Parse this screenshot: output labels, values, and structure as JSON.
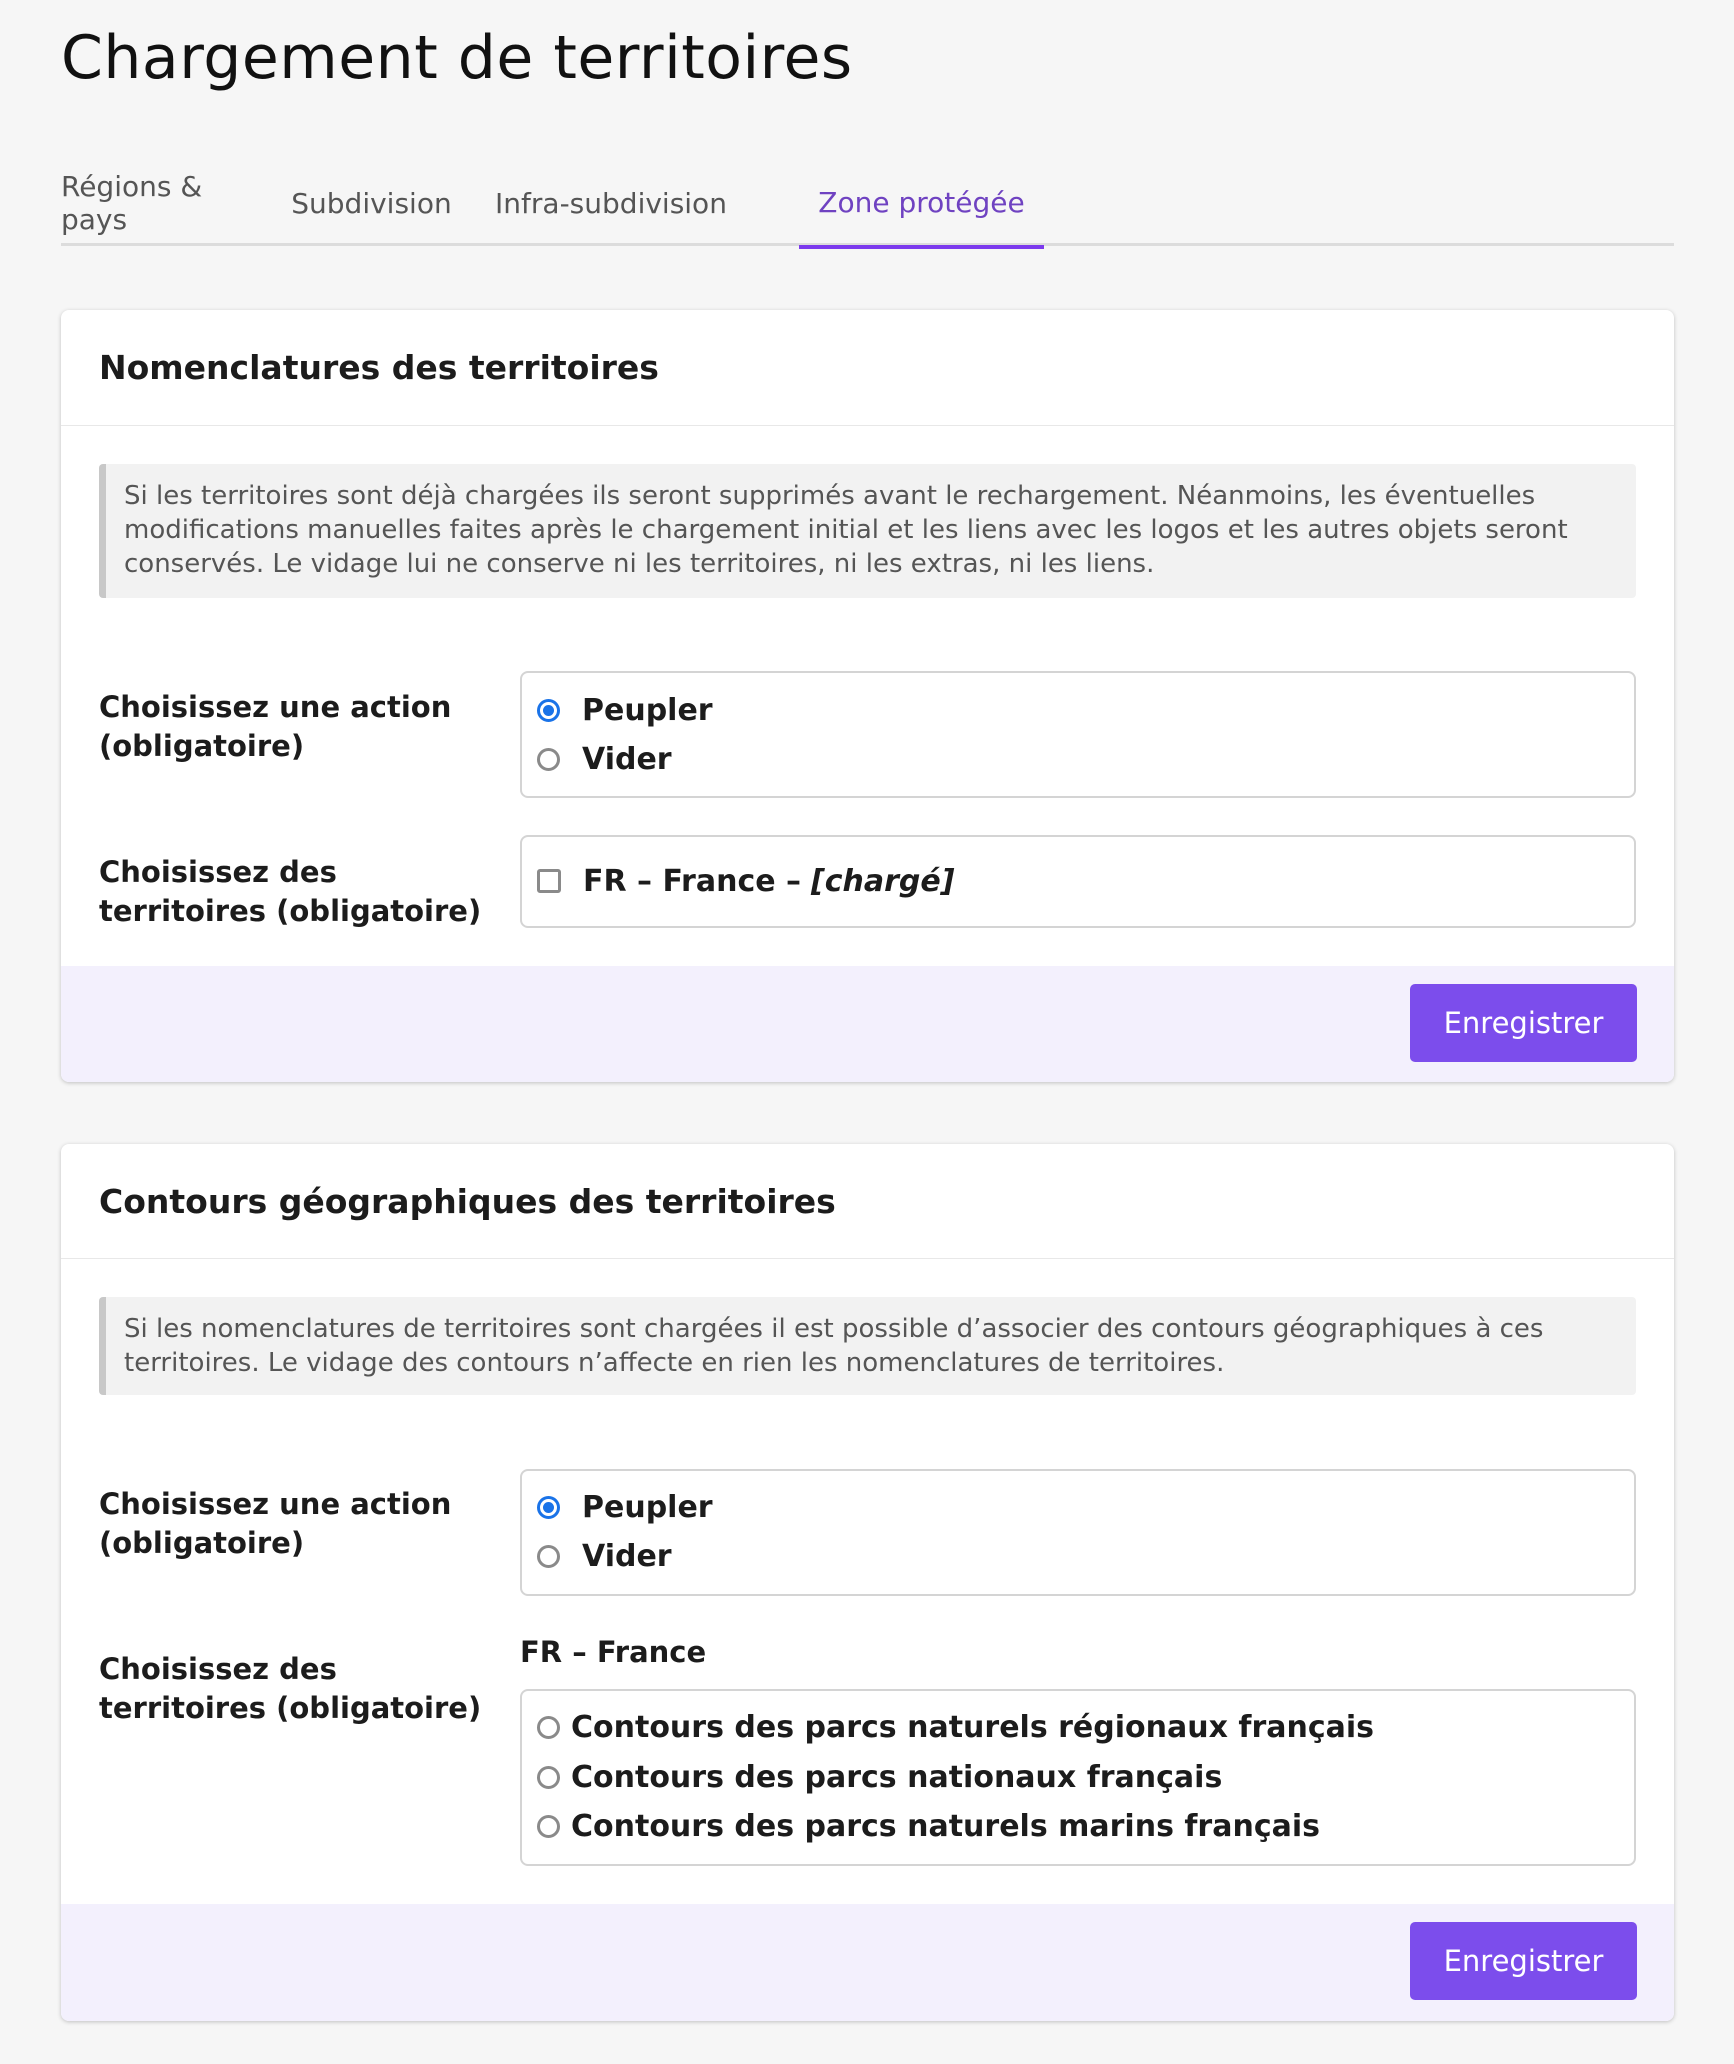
{
  "page": {
    "title": "Chargement de territoires"
  },
  "tabs": [
    {
      "label": "Régions & pays",
      "active": false
    },
    {
      "label": "Subdivision",
      "active": false
    },
    {
      "label": "Infra-subdivision",
      "active": false
    },
    {
      "label": "Zone protégée",
      "active": true
    }
  ],
  "nomenclatures": {
    "title": "Nomenclatures des territoires",
    "notice": "Si les territoires sont déjà chargées ils seront supprimés avant le rechargement. Néanmoins, les éventuelles modifications manuelles faites après le chargement initial et les liens avec les logos et les autres objets seront conservés. Le vidage lui ne conserve ni les territoires, ni les extras, ni les liens.",
    "action_label": "Choisissez une action (obligatoire)",
    "actions": [
      {
        "label": "Peupler",
        "checked": true
      },
      {
        "label": "Vider",
        "checked": false
      }
    ],
    "territories_label": "Choisissez des territoires (obligatoire)",
    "territory": {
      "label": "FR – France –",
      "status": "[chargé]",
      "checked": false
    },
    "save_label": "Enregistrer"
  },
  "contours": {
    "title": "Contours géographiques des territoires",
    "notice": "Si les nomenclatures de territoires sont chargées il est possible d’associer des contours géographiques à ces territoires. Le vidage des contours n’affecte en rien les nomenclatures de territoires.",
    "action_label": "Choisissez une action (obligatoire)",
    "actions": [
      {
        "label": "Peupler",
        "checked": true
      },
      {
        "label": "Vider",
        "checked": false
      }
    ],
    "territories_label": "Choisissez des territoires (obligatoire)",
    "group_title": "FR – France",
    "options": [
      {
        "label": "Contours des parcs naturels régionaux français",
        "checked": false
      },
      {
        "label": "Contours des parcs nationaux français",
        "checked": false
      },
      {
        "label": "Contours des parcs naturels marins français",
        "checked": false
      }
    ],
    "save_label": "Enregistrer"
  },
  "colors": {
    "accent": "#7c4dec",
    "tab_active": "#6f42c1",
    "radio_checked": "#1a73e8",
    "footer_bg": "#f3f0fd"
  }
}
